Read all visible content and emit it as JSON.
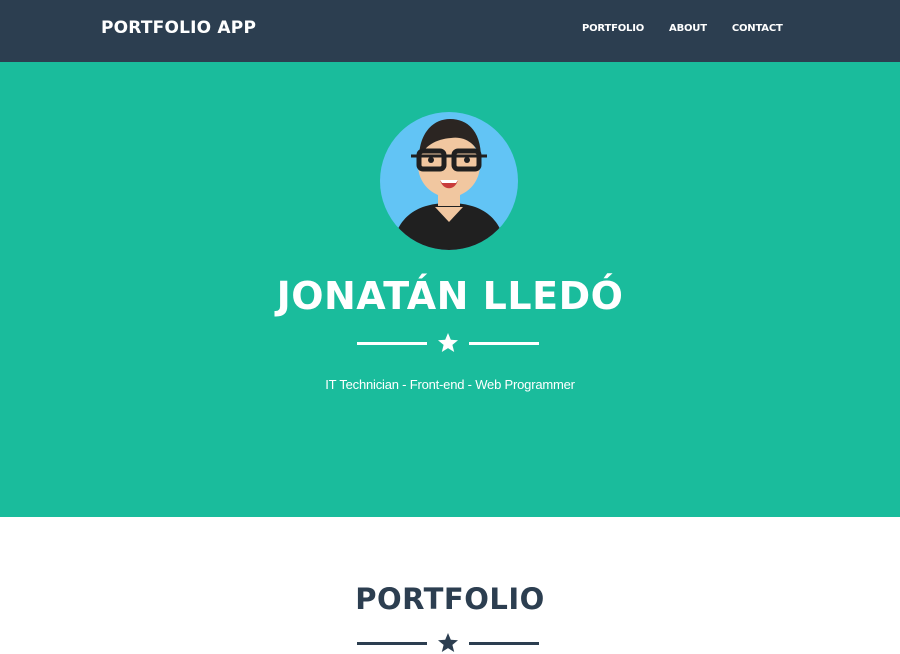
{
  "navbar": {
    "brand": "PORTFOLIO APP",
    "links": [
      "PORTFOLIO",
      "ABOUT",
      "CONTACT"
    ],
    "background": "#2c3e50"
  },
  "masthead": {
    "name": "JONATÁN LLEDÓ",
    "subheading": "IT Technician - Front-end - Web Programmer",
    "background": "#1abc9c",
    "divider_icon": "star-icon"
  },
  "portfolio": {
    "heading": "PORTFOLIO",
    "divider_icon": "star-icon",
    "heading_color": "#2c3e50"
  },
  "colors": {
    "accent": "#1abc9c",
    "primary": "#2c3e50",
    "white": "#ffffff"
  }
}
